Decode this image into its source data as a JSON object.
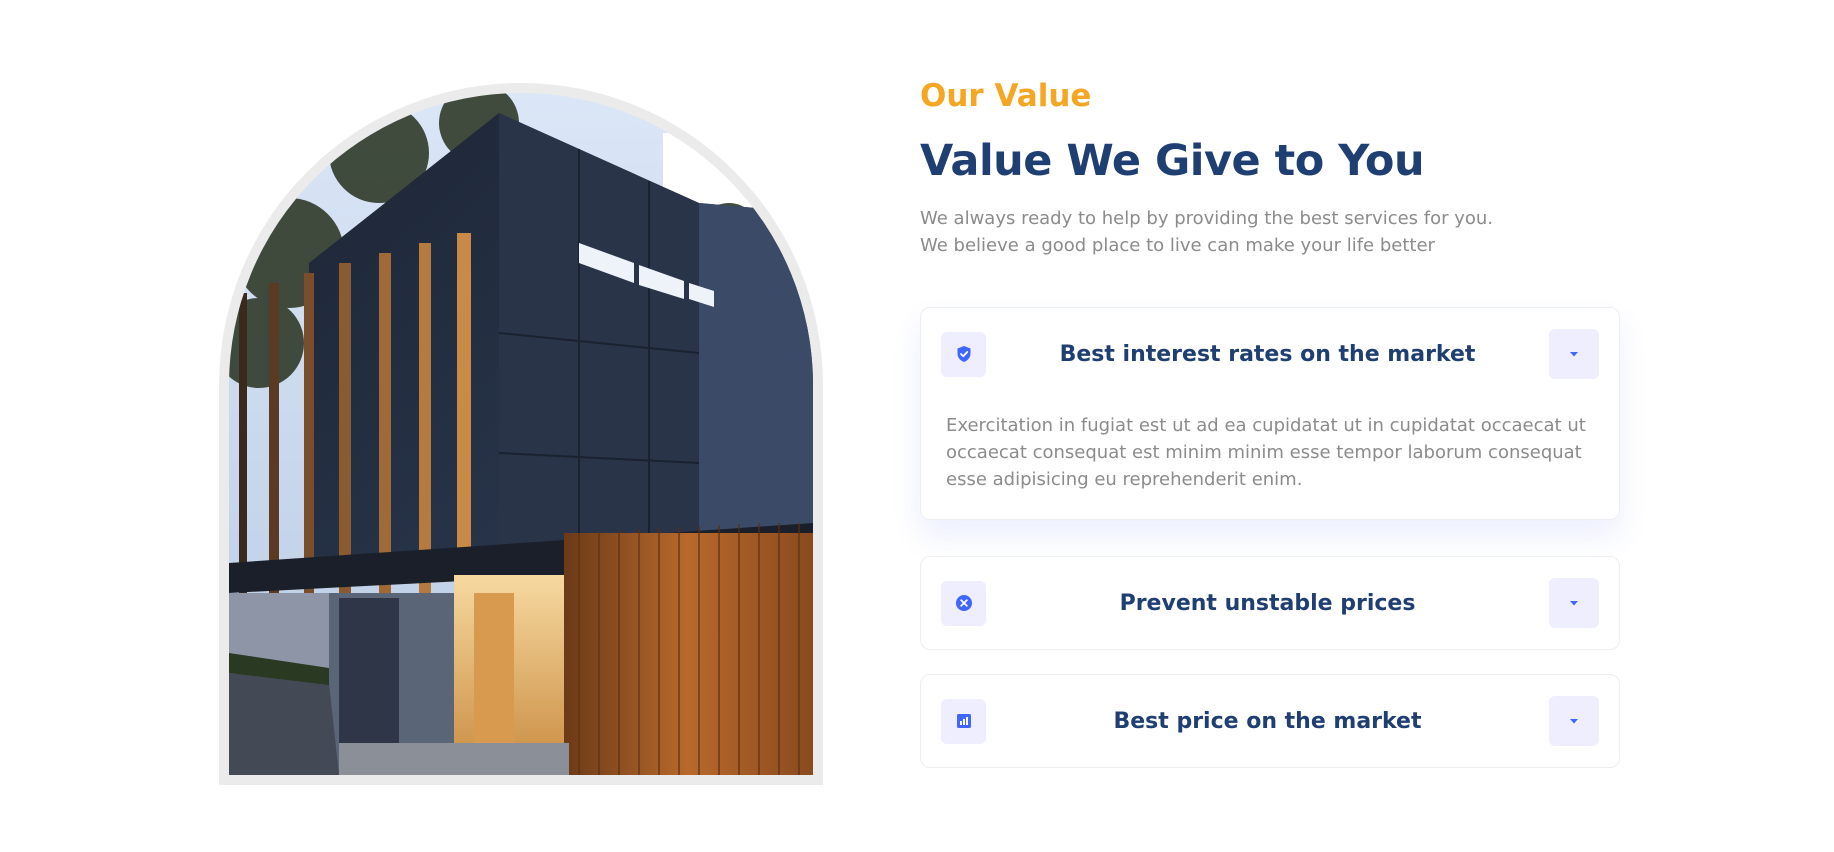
{
  "section": {
    "eyebrow": "Our Value",
    "title": "Value We Give to You",
    "subtitle_lines": [
      "We always ready to help by providing the best services for you.",
      "We believe a good place to live can make your life better"
    ]
  },
  "accordion": {
    "items": [
      {
        "title": "Best interest rates on the market",
        "icon": "shield-check-icon",
        "expanded": true,
        "body": "Exercitation in fugiat est ut ad ea cupidatat ut in cupidatat occaecat ut occaecat consequat est minim minim esse tempor laborum consequat esse adipisicing eu reprehenderit enim."
      },
      {
        "title": "Prevent unstable prices",
        "icon": "close-circle-icon",
        "expanded": false
      },
      {
        "title": "Best price on the market",
        "icon": "bar-chart-icon",
        "expanded": false
      }
    ],
    "toggle_icon": "caret-down-icon"
  },
  "colors": {
    "accent": "#f5a623",
    "heading": "#1f3e72",
    "text_muted": "#8c8b8b",
    "icon_blue": "#4066ff",
    "icon_bg": "#eeeeff",
    "image_border": "#ebebeb"
  }
}
